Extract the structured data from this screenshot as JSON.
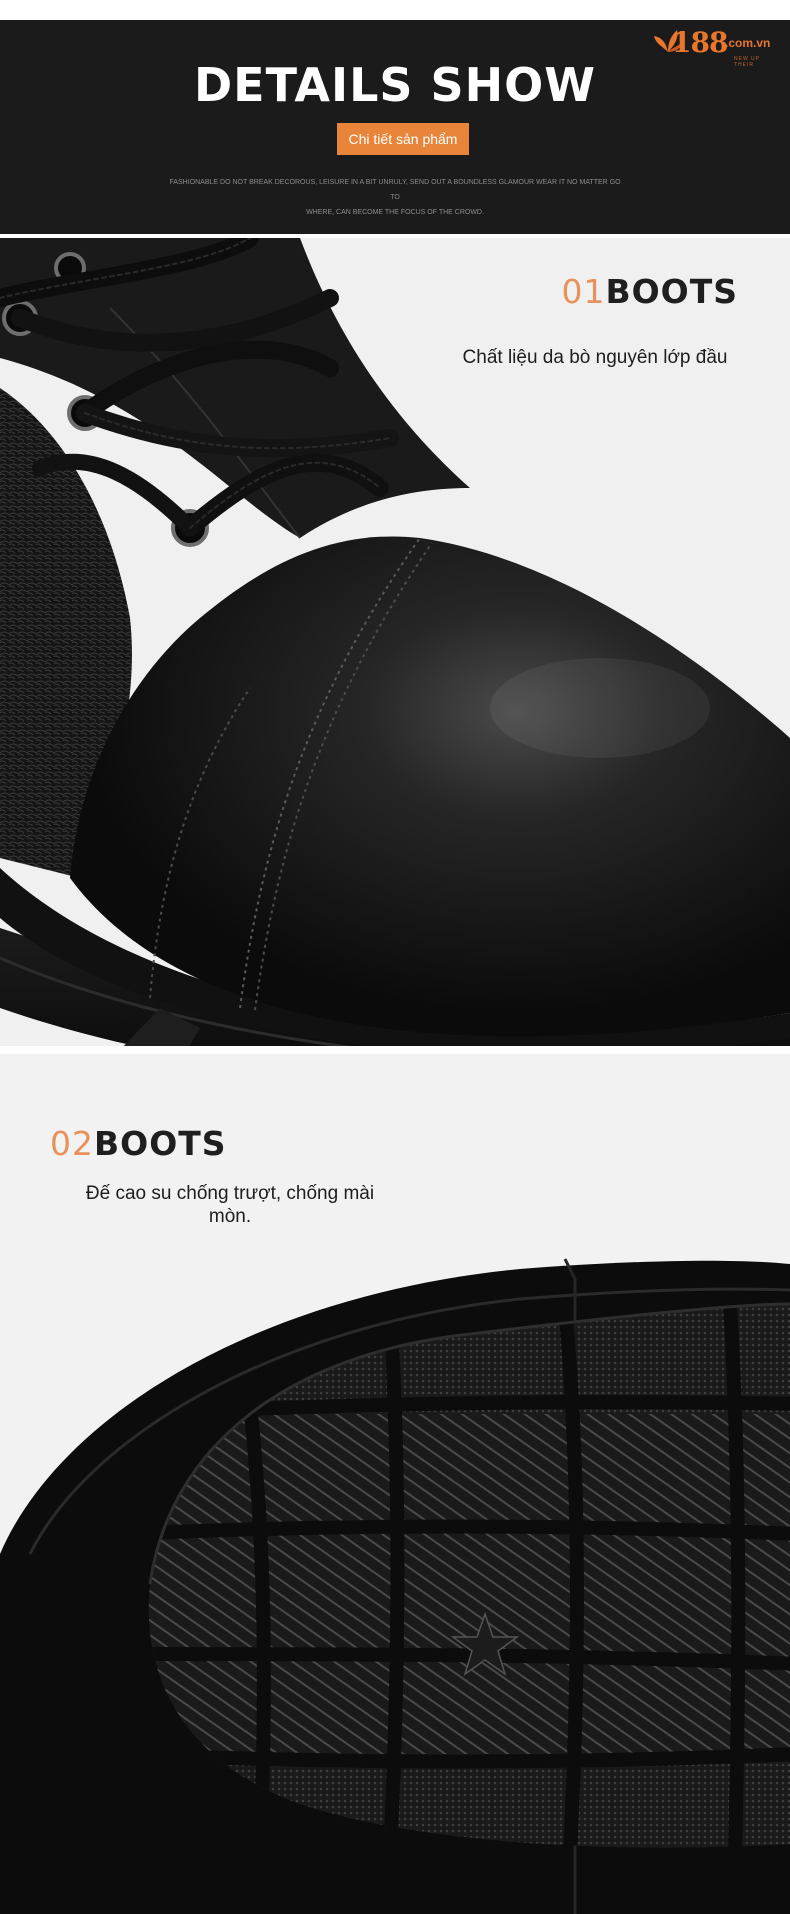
{
  "header": {
    "title": "DETAILS SHOW",
    "badge": "Chi tiết sản phẩm",
    "tagline_line1": "FASHIONABLE DO NOT BREAK DECOROUS, LEISURE IN A BIT UNRULY, SEND OUT A BOUNDLESS GLAMOUR WEAR IT NO MATTER GO TO",
    "tagline_line2": "WHERE, CAN BECOME THE FOCUS OF THE CROWD."
  },
  "logo": {
    "number": "188",
    "domain": ".com.vn",
    "slogan": "NEW UP THEIR",
    "icon": "leaf-logo-icon",
    "color": "#e8762b"
  },
  "sections": [
    {
      "number": "01",
      "word": "BOOTS",
      "description": "Chất liệu da bò nguyên lớp đầu",
      "image": "boot-toe-closeup-image"
    },
    {
      "number": "02",
      "word": "BOOTS",
      "description": "Đế cao su chống trượt, chống mài mòn.",
      "image": "rubber-sole-image"
    }
  ],
  "colors": {
    "accent": "#e8853a",
    "header_bg": "#1c1b1b",
    "panel_bg": "#f1f0f0",
    "number_color": "#e8915a"
  }
}
